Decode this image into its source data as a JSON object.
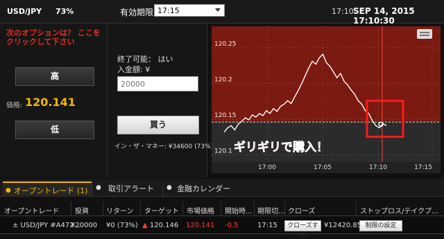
{
  "header": {
    "pair": "USD/JPY",
    "payout_pct": "73%",
    "expiry_label": "有効期限:",
    "expiry_value": "17:15",
    "clock_short": "17:10",
    "clock_full": "SEP 14, 2015 17:10:30"
  },
  "left_panel": {
    "next_option": "次のオプションは？ ここをクリックして下さい",
    "high_label": "高",
    "price_label": "価格:",
    "price_value": "120.141",
    "low_label": "低"
  },
  "middle_panel": {
    "tradable": "終了可能： はい",
    "deposit_label": "入金額: ¥",
    "amount_value": "20000",
    "buy_label": "買う",
    "in_the_money": "イン・ザ・マネー: ¥34600 (73%)"
  },
  "chart_data": {
    "type": "line",
    "x_ticks": [
      "17:00",
      "17:05",
      "17:10",
      "17:15"
    ],
    "y_ticks": [
      "120.25",
      "120.2",
      "120.15",
      "120.1"
    ],
    "ylim": [
      120.09,
      120.28
    ],
    "target_level": 120.146,
    "annotation": "ギリギリで購入！",
    "colors": {
      "background": "#7a1a10",
      "below_target": "#2b2b2b",
      "line": "#ffffff",
      "highlight_box": "#ff1a1a"
    },
    "series": [
      {
        "values": [
          120.132,
          120.138,
          120.141,
          120.135,
          120.143,
          120.147,
          120.152,
          120.149,
          120.156,
          120.153,
          120.158,
          120.155,
          120.162,
          120.158,
          120.165,
          120.161,
          120.168,
          120.171,
          120.176,
          120.172,
          120.181,
          120.19,
          120.2,
          120.211,
          120.222,
          120.231,
          120.227,
          120.236,
          120.241,
          120.229,
          120.224,
          120.216,
          120.208,
          120.214,
          120.203,
          120.198,
          120.191,
          120.185,
          120.176,
          120.171,
          120.162,
          120.158,
          120.148,
          120.141,
          120.138,
          120.144,
          120.141
        ]
      }
    ]
  },
  "tabs": {
    "open_trades": "オープントレード (1)",
    "trade_alert": "取引アラート",
    "calendar": "金融カレンダー"
  },
  "table": {
    "headers": [
      "オープントレード",
      "投資",
      "リターン",
      "ターゲット",
      "市場価格",
      "開始時...",
      "期限切...",
      "クローズ",
      "ストップロス/テイクプ..."
    ],
    "row": {
      "trade": "± USD/JPY #A472...",
      "investment": "¥20000",
      "return": "¥0 (73%)",
      "target": "▲ 120.146",
      "market_price": "120.141",
      "start": "-0.5",
      "expiry": "17:15",
      "close_button": "クローズする",
      "close_amount": "¥12420.85",
      "limit_button": "制限の設定"
    }
  }
}
